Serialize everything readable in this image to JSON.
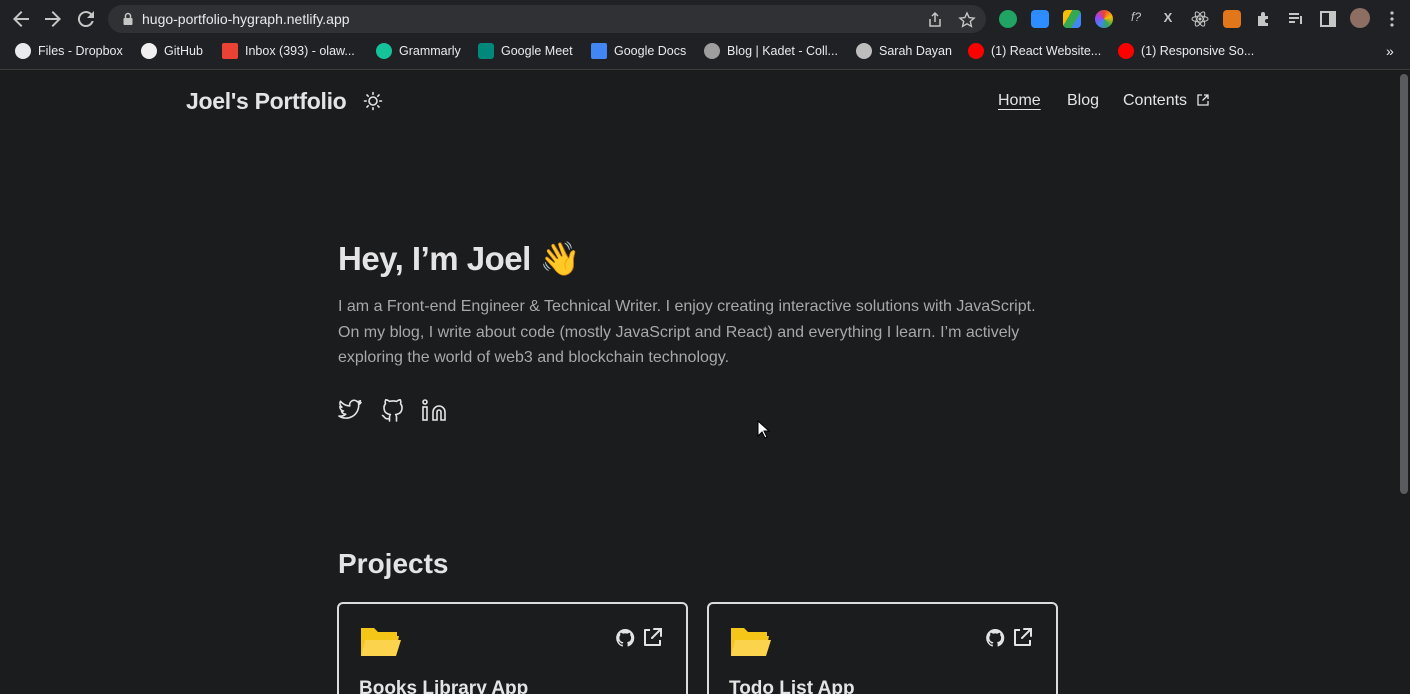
{
  "browser": {
    "url": "hugo-portfolio-hygraph.netlify.app",
    "bookmarks": [
      {
        "label": "Files - Dropbox",
        "icon": "globe-icon"
      },
      {
        "label": "GitHub",
        "icon": "github-icon"
      },
      {
        "label": "Inbox (393) - olaw...",
        "icon": "gmail-icon"
      },
      {
        "label": "Grammarly",
        "icon": "grammarly-icon"
      },
      {
        "label": "Google Meet",
        "icon": "google-meet-icon"
      },
      {
        "label": "Google Docs",
        "icon": "google-docs-icon"
      },
      {
        "label": "Blog | Kadet - Coll...",
        "icon": "kadet-icon"
      },
      {
        "label": "Sarah Dayan",
        "icon": "avatar-icon"
      },
      {
        "label": "(1) React Website...",
        "icon": "youtube-icon"
      },
      {
        "label": "(1) Responsive So...",
        "icon": "youtube-icon"
      }
    ],
    "more_bookmarks": "»"
  },
  "site": {
    "title": "Joel's Portfolio",
    "nav": [
      {
        "label": "Home",
        "active": true
      },
      {
        "label": "Blog",
        "active": false
      },
      {
        "label": "Contents",
        "active": false
      }
    ]
  },
  "hero": {
    "title": "Hey, I’m Joel 👋",
    "text": "I am a Front-end Engineer & Technical Writer. I enjoy creating interactive solutions with JavaScript. On my blog, I write about code (mostly JavaScript and React) and everything I learn. I’m actively exploring the world of web3 and blockchain technology."
  },
  "projects": {
    "title": "Projects",
    "items": [
      {
        "title": "Books Library App"
      },
      {
        "title": "Todo List App"
      }
    ]
  },
  "colors": {
    "background": "#1b1c1e",
    "text": "#e4e4e4",
    "muted": "#a8a8a8",
    "folder": "#f5c518"
  }
}
